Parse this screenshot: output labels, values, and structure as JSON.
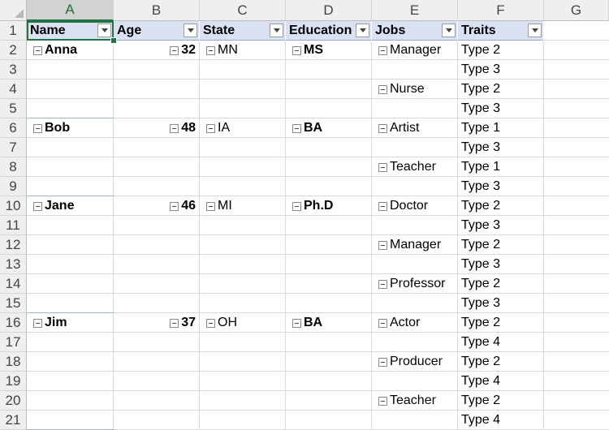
{
  "columns": [
    "A",
    "B",
    "C",
    "D",
    "E",
    "F",
    "G"
  ],
  "selected_column": "A",
  "rows": [
    "1",
    "2",
    "3",
    "4",
    "5",
    "6",
    "7",
    "8",
    "9",
    "10",
    "11",
    "12",
    "13",
    "14",
    "15",
    "16",
    "17",
    "18",
    "19",
    "20",
    "21"
  ],
  "pivot": {
    "headers": [
      "Name",
      "Age",
      "State",
      "Education",
      "Jobs",
      "Traits"
    ],
    "people": [
      {
        "name": "Anna",
        "age": "32",
        "state": "MN",
        "education": "MS",
        "jobs": [
          {
            "job": "Manager",
            "traits": [
              "Type 2",
              "Type 3"
            ]
          },
          {
            "job": "Nurse",
            "traits": [
              "Type 2",
              "Type 3"
            ]
          }
        ]
      },
      {
        "name": "Bob",
        "age": "48",
        "state": "IA",
        "education": "BA",
        "jobs": [
          {
            "job": "Artist",
            "traits": [
              "Type 1",
              "Type 3"
            ]
          },
          {
            "job": "Teacher",
            "traits": [
              "Type 1",
              "Type 3"
            ]
          }
        ]
      },
      {
        "name": "Jane",
        "age": "46",
        "state": "MI",
        "education": "Ph.D",
        "jobs": [
          {
            "job": "Doctor",
            "traits": [
              "Type 2",
              "Type 3"
            ]
          },
          {
            "job": "Manager",
            "traits": [
              "Type 2",
              "Type 3"
            ]
          },
          {
            "job": "Professor",
            "traits": [
              "Type 2",
              "Type 3"
            ]
          }
        ]
      },
      {
        "name": "Jim",
        "age": "37",
        "state": "OH",
        "education": "BA",
        "jobs": [
          {
            "job": "Actor",
            "traits": [
              "Type 2",
              "Type 4"
            ]
          },
          {
            "job": "Producer",
            "traits": [
              "Type 2",
              "Type 4"
            ]
          },
          {
            "job": "Teacher",
            "traits": [
              "Type 2",
              "Type 4"
            ]
          }
        ]
      }
    ]
  },
  "colors": {
    "pivot_header_bg": "#d9e1f2",
    "selection": "#217346",
    "grid": "#dadada"
  }
}
